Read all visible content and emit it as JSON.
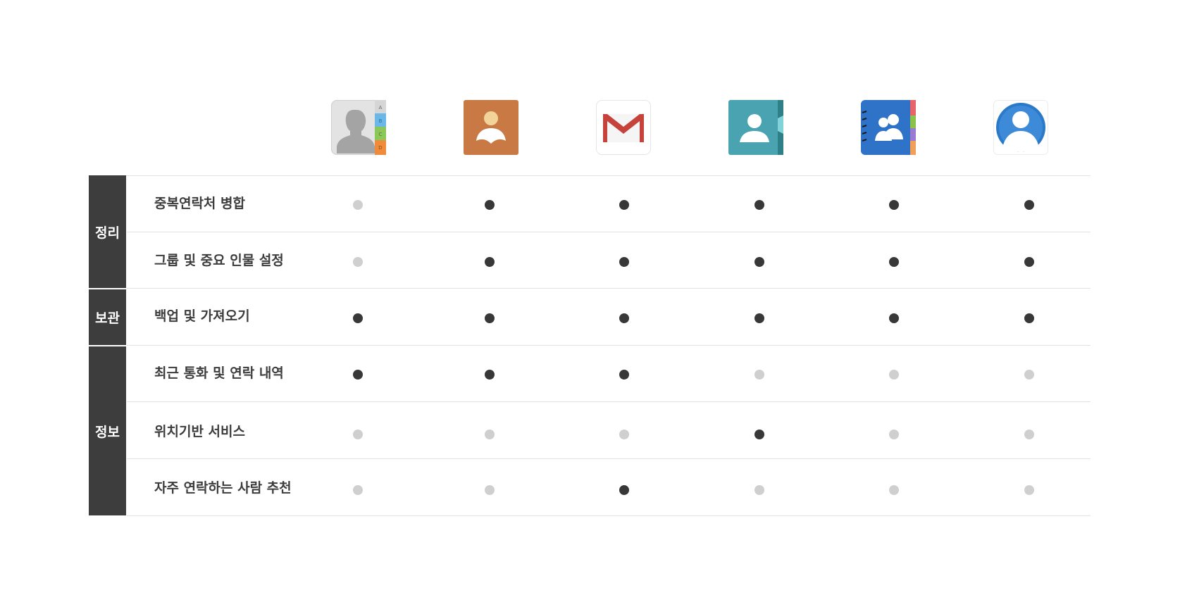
{
  "apps": [
    {
      "icon": "ios-contacts-icon"
    },
    {
      "icon": "android-contacts-icon"
    },
    {
      "icon": "gmail-icon"
    },
    {
      "icon": "people-contacts-icon"
    },
    {
      "icon": "address-book-icon"
    },
    {
      "icon": "profile-app-icon"
    }
  ],
  "categories": [
    {
      "label": "정리"
    },
    {
      "label": "보관"
    },
    {
      "label": "정보"
    }
  ],
  "features": [
    {
      "label": "중복연락처 병합",
      "support": [
        false,
        true,
        true,
        true,
        true,
        true
      ]
    },
    {
      "label": "그룹 및 중요 인물 설정",
      "support": [
        false,
        true,
        true,
        true,
        true,
        true
      ]
    },
    {
      "label": "백업 및 가져오기",
      "support": [
        true,
        true,
        true,
        true,
        true,
        true
      ]
    },
    {
      "label": "최근 통화 및 연락 내역",
      "support": [
        true,
        true,
        true,
        false,
        false,
        false
      ]
    },
    {
      "label": "위치기반 서비스",
      "support": [
        false,
        false,
        false,
        true,
        false,
        false
      ]
    },
    {
      "label": "자주 연락하는 사람 추천",
      "support": [
        false,
        false,
        true,
        false,
        false,
        false
      ]
    }
  ],
  "colors": {
    "supported": "#383838",
    "unsupported": "#cfcfcf",
    "category_bg": "#3d3d3d"
  }
}
